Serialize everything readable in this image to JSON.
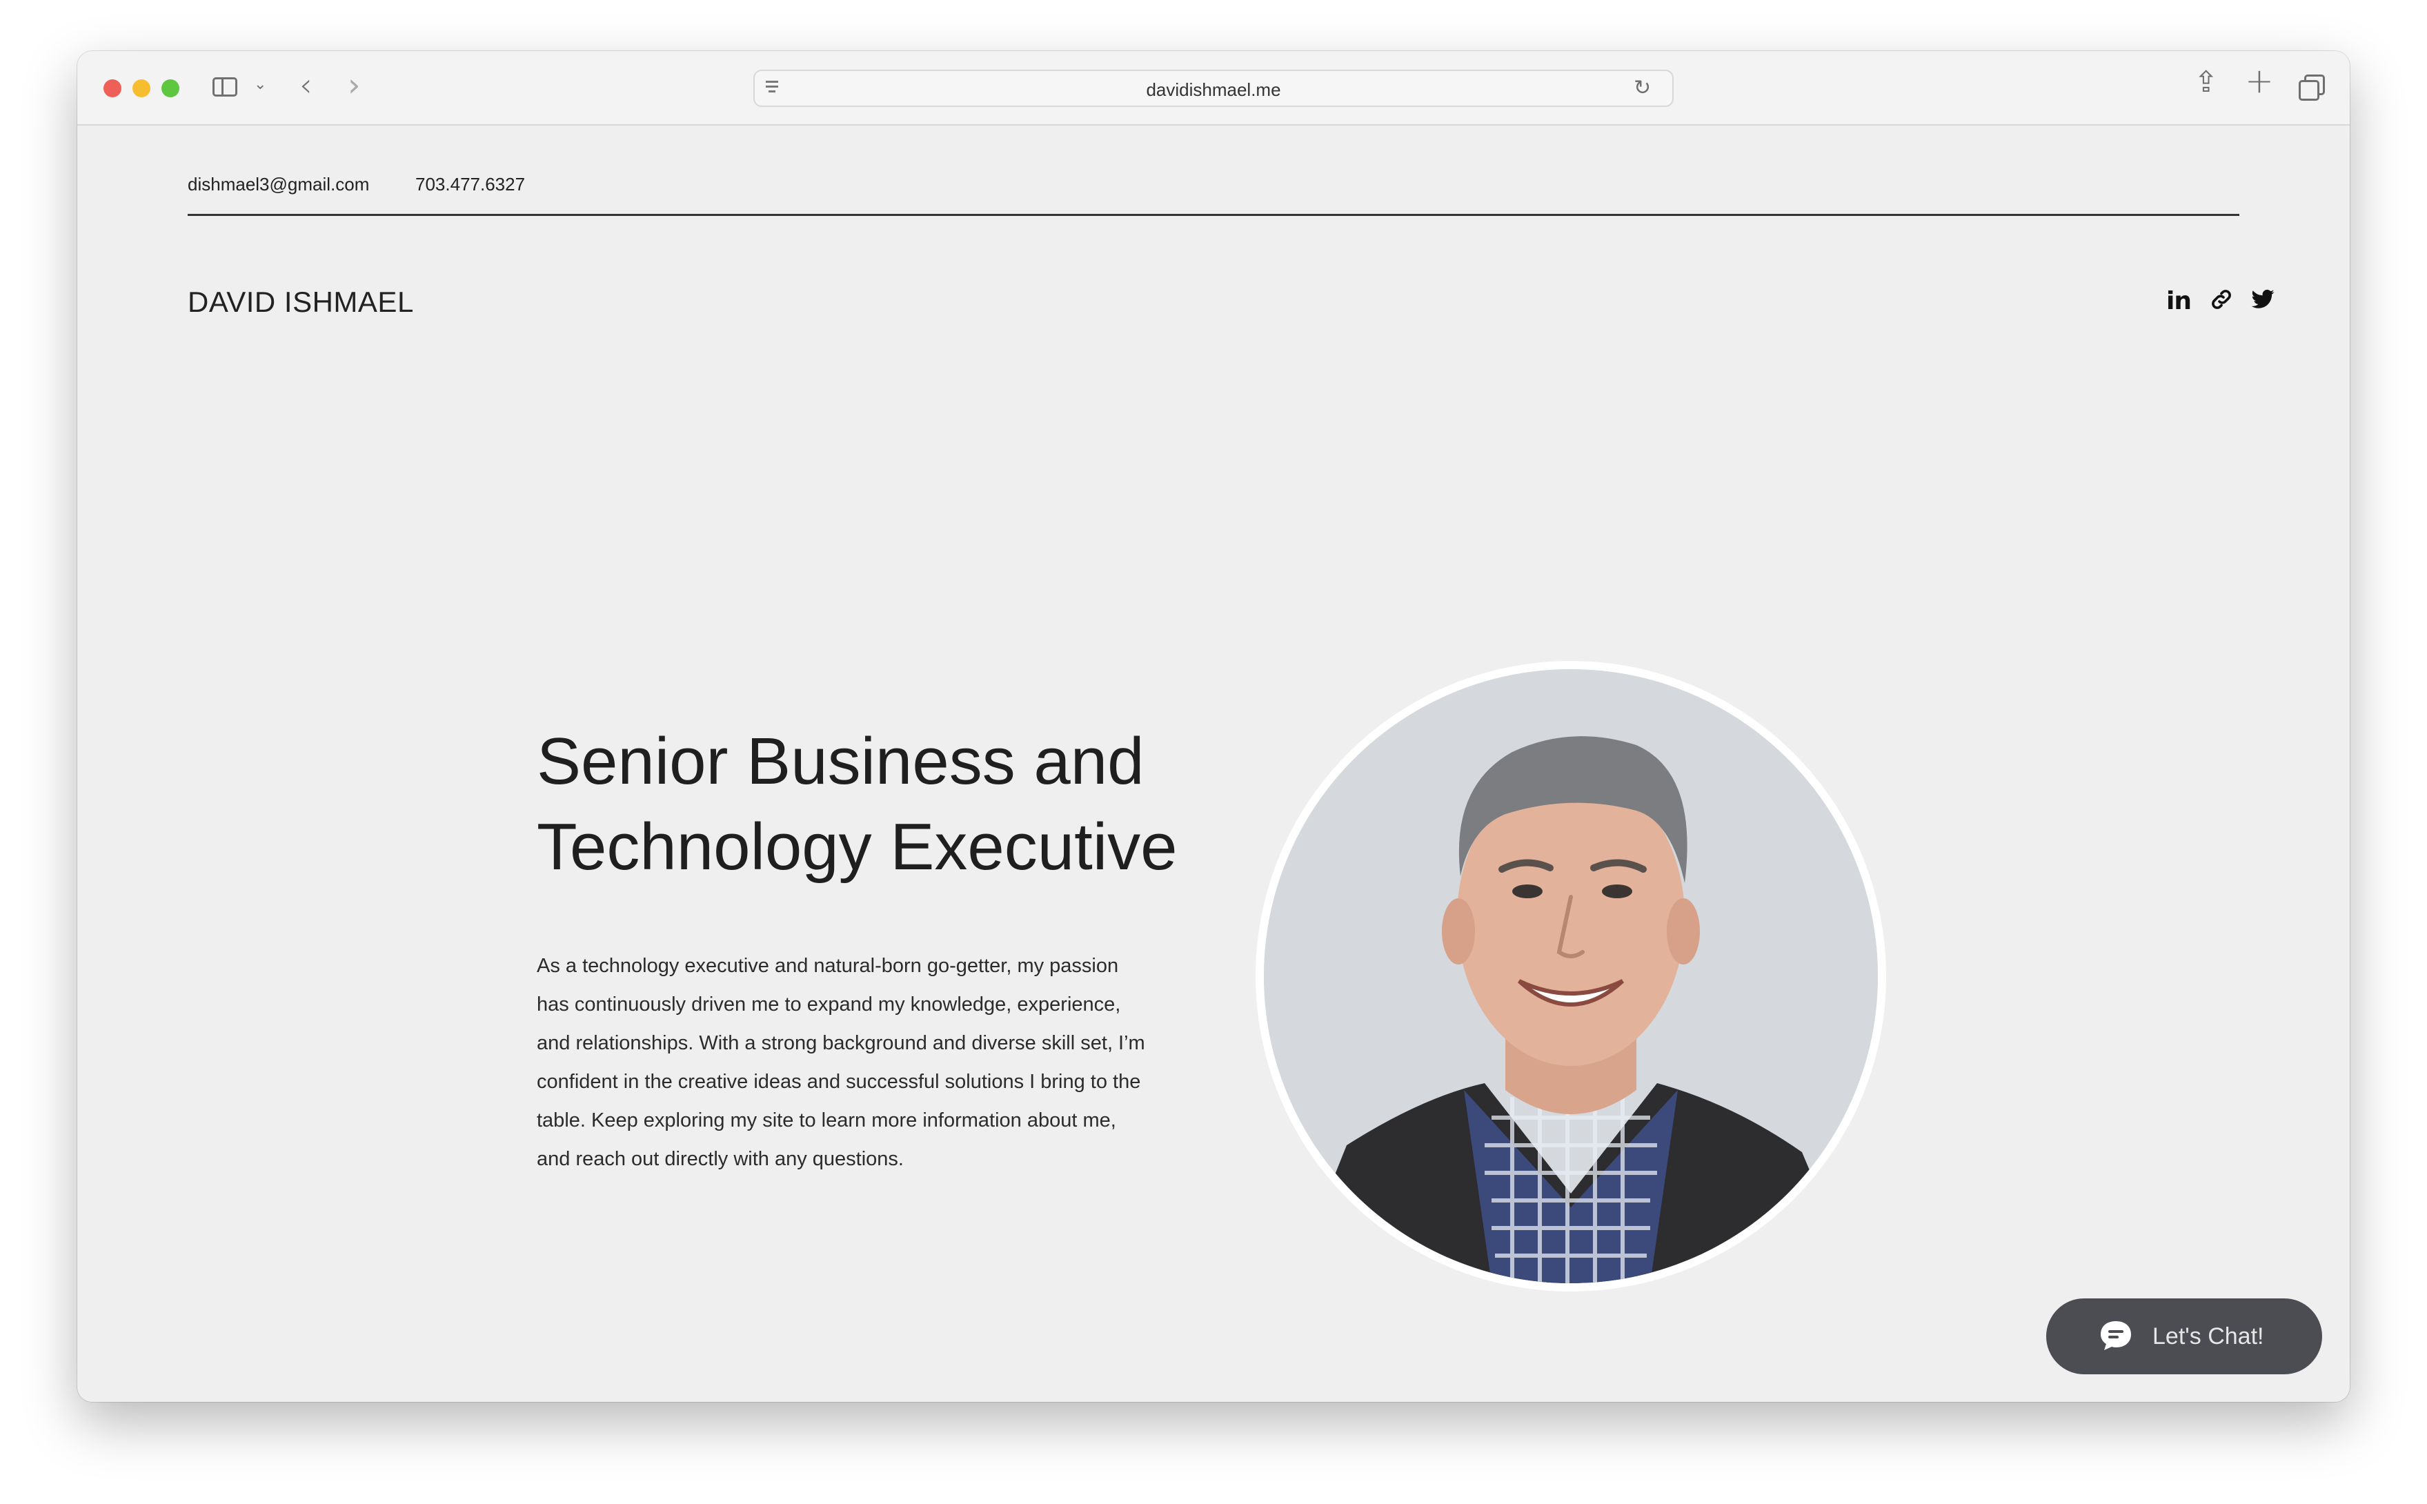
{
  "browser": {
    "url": "davidishmael.me"
  },
  "header": {
    "email": "dishmael3@gmail.com",
    "phone": "703.477.6327",
    "site_name": "DAVID ISHMAEL",
    "social": {
      "linkedin_label": "in"
    }
  },
  "hero": {
    "headline_line1": "Senior Business and",
    "headline_line2": "Technology Executive",
    "bio_lines": [
      "As a technology executive and natural-born go-getter, my passion",
      "has continuously driven me to expand my knowledge, experience,",
      "and relationships. With a strong background and diverse skill set, I’m",
      "confident in the creative ideas and successful solutions I bring to the",
      "table. Keep exploring my site to learn more information about me,",
      "and reach out directly with any questions."
    ]
  },
  "chat": {
    "label": "Let's Chat!"
  },
  "icons": {
    "reload": "reload-icon",
    "share": "share-icon",
    "new_tab": "plus-icon",
    "tabs": "tabs-icon",
    "chat": "chat-bubble-icon"
  },
  "colors": {
    "page_background": "#efefef",
    "chat_button": "#4b4d52",
    "traffic_close": "#ee5f57",
    "traffic_minimize": "#f5bd2f",
    "traffic_maximize": "#5fc73f"
  }
}
